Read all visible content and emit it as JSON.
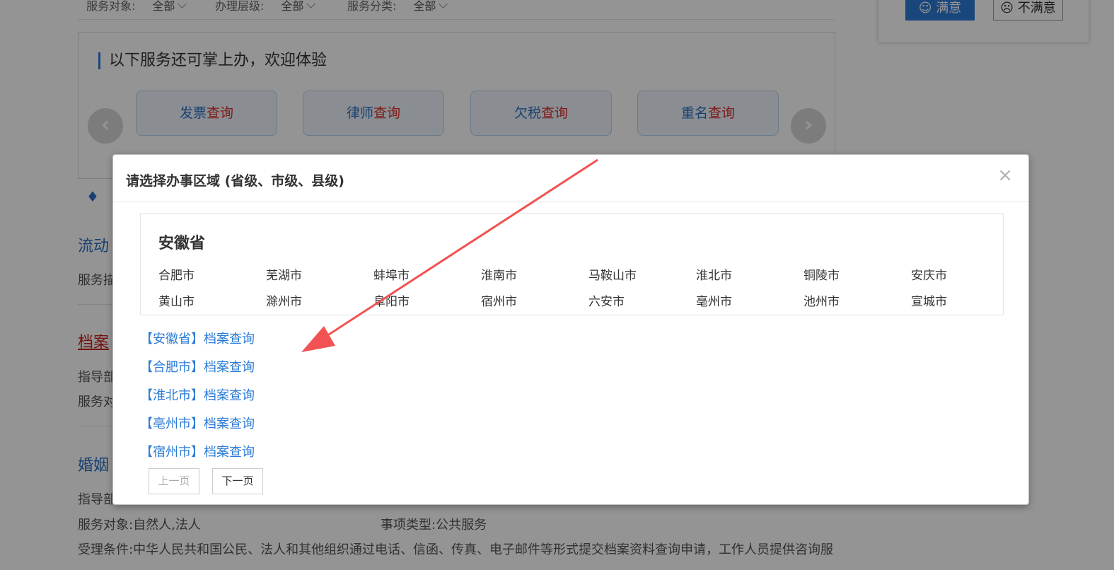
{
  "filters": {
    "service_target_label": "服务对象:",
    "service_target_value": "全部",
    "level_label": "办理层级:",
    "level_value": "全部",
    "category_label": "服务分类:",
    "category_value": "全部"
  },
  "satisfaction": {
    "ok_label": "满意",
    "no_label": "不满意"
  },
  "promo": {
    "title": "以下服务还可掌上办，欢迎体验",
    "cards": [
      {
        "prefix": "发票",
        "suffix": "查询"
      },
      {
        "prefix": "律师",
        "suffix": "查询"
      },
      {
        "prefix": "欠税",
        "suffix": "查询"
      },
      {
        "prefix": "重名",
        "suffix": "查询"
      }
    ],
    "prev_icon": "‹",
    "next_icon": "›"
  },
  "list": {
    "item1_title": "流动",
    "item1_desc": "服务描",
    "item2_title": "档案",
    "item2_line1": "指导部",
    "item2_line2": "服务对",
    "item3_title": "婚姻",
    "item3_line1": "指导部",
    "service_target": "服务对象:自然人,法人",
    "item_type": "事项类型:公共服务",
    "condition": "受理条件:中华人民共和国公民、法人和其他组织通过电话、信函、传真、电子邮件等形式提交档案资料查询申请，工作人员提供咨询服"
  },
  "modal": {
    "title": "请选择办事区域 (省级、市级、县级)",
    "close": "×",
    "province": "安徽省",
    "cities": [
      "合肥市",
      "芜湖市",
      "蚌埠市",
      "淮南市",
      "马鞍山市",
      "淮北市",
      "铜陵市",
      "安庆市",
      "黄山市",
      "滁州市",
      "阜阳市",
      "宿州市",
      "六安市",
      "亳州市",
      "池州市",
      "宣城市"
    ],
    "results": [
      "【安徽省】档案查询",
      "【合肥市】档案查询",
      "【淮北市】档案查询",
      "【亳州市】档案查询",
      "【宿州市】档案查询"
    ],
    "prev_page": "上一页",
    "next_page": "下一页"
  }
}
